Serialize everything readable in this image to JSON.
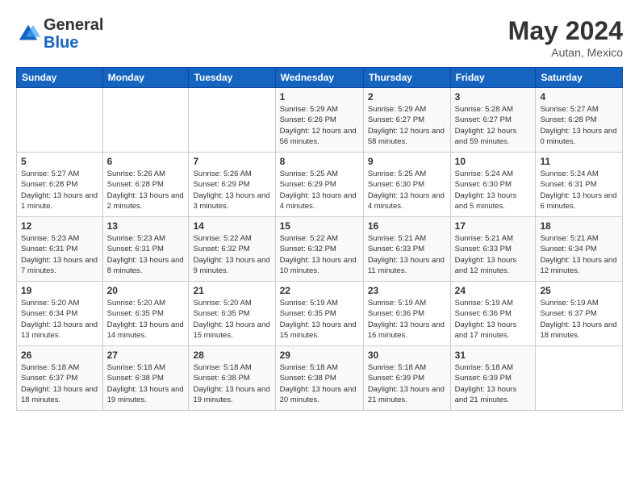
{
  "header": {
    "logo_general": "General",
    "logo_blue": "Blue",
    "month_year": "May 2024",
    "location": "Autan, Mexico"
  },
  "days_of_week": [
    "Sunday",
    "Monday",
    "Tuesday",
    "Wednesday",
    "Thursday",
    "Friday",
    "Saturday"
  ],
  "weeks": [
    [
      {
        "day": "",
        "info": ""
      },
      {
        "day": "",
        "info": ""
      },
      {
        "day": "",
        "info": ""
      },
      {
        "day": "1",
        "info": "Sunrise: 5:29 AM\nSunset: 6:26 PM\nDaylight: 12 hours and 56 minutes."
      },
      {
        "day": "2",
        "info": "Sunrise: 5:29 AM\nSunset: 6:27 PM\nDaylight: 12 hours and 58 minutes."
      },
      {
        "day": "3",
        "info": "Sunrise: 5:28 AM\nSunset: 6:27 PM\nDaylight: 12 hours and 59 minutes."
      },
      {
        "day": "4",
        "info": "Sunrise: 5:27 AM\nSunset: 6:28 PM\nDaylight: 13 hours and 0 minutes."
      }
    ],
    [
      {
        "day": "5",
        "info": "Sunrise: 5:27 AM\nSunset: 6:28 PM\nDaylight: 13 hours and 1 minute."
      },
      {
        "day": "6",
        "info": "Sunrise: 5:26 AM\nSunset: 6:28 PM\nDaylight: 13 hours and 2 minutes."
      },
      {
        "day": "7",
        "info": "Sunrise: 5:26 AM\nSunset: 6:29 PM\nDaylight: 13 hours and 3 minutes."
      },
      {
        "day": "8",
        "info": "Sunrise: 5:25 AM\nSunset: 6:29 PM\nDaylight: 13 hours and 4 minutes."
      },
      {
        "day": "9",
        "info": "Sunrise: 5:25 AM\nSunset: 6:30 PM\nDaylight: 13 hours and 4 minutes."
      },
      {
        "day": "10",
        "info": "Sunrise: 5:24 AM\nSunset: 6:30 PM\nDaylight: 13 hours and 5 minutes."
      },
      {
        "day": "11",
        "info": "Sunrise: 5:24 AM\nSunset: 6:31 PM\nDaylight: 13 hours and 6 minutes."
      }
    ],
    [
      {
        "day": "12",
        "info": "Sunrise: 5:23 AM\nSunset: 6:31 PM\nDaylight: 13 hours and 7 minutes."
      },
      {
        "day": "13",
        "info": "Sunrise: 5:23 AM\nSunset: 6:31 PM\nDaylight: 13 hours and 8 minutes."
      },
      {
        "day": "14",
        "info": "Sunrise: 5:22 AM\nSunset: 6:32 PM\nDaylight: 13 hours and 9 minutes."
      },
      {
        "day": "15",
        "info": "Sunrise: 5:22 AM\nSunset: 6:32 PM\nDaylight: 13 hours and 10 minutes."
      },
      {
        "day": "16",
        "info": "Sunrise: 5:21 AM\nSunset: 6:33 PM\nDaylight: 13 hours and 11 minutes."
      },
      {
        "day": "17",
        "info": "Sunrise: 5:21 AM\nSunset: 6:33 PM\nDaylight: 13 hours and 12 minutes."
      },
      {
        "day": "18",
        "info": "Sunrise: 5:21 AM\nSunset: 6:34 PM\nDaylight: 13 hours and 12 minutes."
      }
    ],
    [
      {
        "day": "19",
        "info": "Sunrise: 5:20 AM\nSunset: 6:34 PM\nDaylight: 13 hours and 13 minutes."
      },
      {
        "day": "20",
        "info": "Sunrise: 5:20 AM\nSunset: 6:35 PM\nDaylight: 13 hours and 14 minutes."
      },
      {
        "day": "21",
        "info": "Sunrise: 5:20 AM\nSunset: 6:35 PM\nDaylight: 13 hours and 15 minutes."
      },
      {
        "day": "22",
        "info": "Sunrise: 5:19 AM\nSunset: 6:35 PM\nDaylight: 13 hours and 15 minutes."
      },
      {
        "day": "23",
        "info": "Sunrise: 5:19 AM\nSunset: 6:36 PM\nDaylight: 13 hours and 16 minutes."
      },
      {
        "day": "24",
        "info": "Sunrise: 5:19 AM\nSunset: 6:36 PM\nDaylight: 13 hours and 17 minutes."
      },
      {
        "day": "25",
        "info": "Sunrise: 5:19 AM\nSunset: 6:37 PM\nDaylight: 13 hours and 18 minutes."
      }
    ],
    [
      {
        "day": "26",
        "info": "Sunrise: 5:18 AM\nSunset: 6:37 PM\nDaylight: 13 hours and 18 minutes."
      },
      {
        "day": "27",
        "info": "Sunrise: 5:18 AM\nSunset: 6:38 PM\nDaylight: 13 hours and 19 minutes."
      },
      {
        "day": "28",
        "info": "Sunrise: 5:18 AM\nSunset: 6:38 PM\nDaylight: 13 hours and 19 minutes."
      },
      {
        "day": "29",
        "info": "Sunrise: 5:18 AM\nSunset: 6:38 PM\nDaylight: 13 hours and 20 minutes."
      },
      {
        "day": "30",
        "info": "Sunrise: 5:18 AM\nSunset: 6:39 PM\nDaylight: 13 hours and 21 minutes."
      },
      {
        "day": "31",
        "info": "Sunrise: 5:18 AM\nSunset: 6:39 PM\nDaylight: 13 hours and 21 minutes."
      },
      {
        "day": "",
        "info": ""
      }
    ]
  ]
}
